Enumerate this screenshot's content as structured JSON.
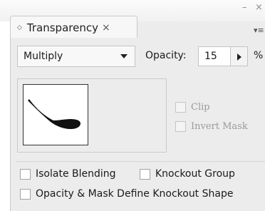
{
  "window": {
    "minimize_glyph": "–",
    "close_glyph": "×",
    "panel_menu_glyph": "▾≡"
  },
  "tab": {
    "icon_glyph": "◇",
    "label": "Transparency",
    "close_glyph": "×"
  },
  "blend_mode": {
    "selected": "Multiply"
  },
  "opacity": {
    "label": "Opacity:",
    "value": "15",
    "unit": "%"
  },
  "mask_options": {
    "clip": {
      "label": "Clip",
      "checked": false,
      "enabled": false
    },
    "invert_mask": {
      "label": "Invert Mask",
      "checked": false,
      "enabled": false
    }
  },
  "options": {
    "isolate_blending": {
      "label": "Isolate Blending",
      "checked": false
    },
    "knockout_group": {
      "label": "Knockout Group",
      "checked": false
    },
    "define_knockout": {
      "label": "Opacity & Mask Define Knockout Shape",
      "checked": false
    }
  },
  "thumbnail": {
    "icon": "spoon-shape-thumbnail"
  }
}
